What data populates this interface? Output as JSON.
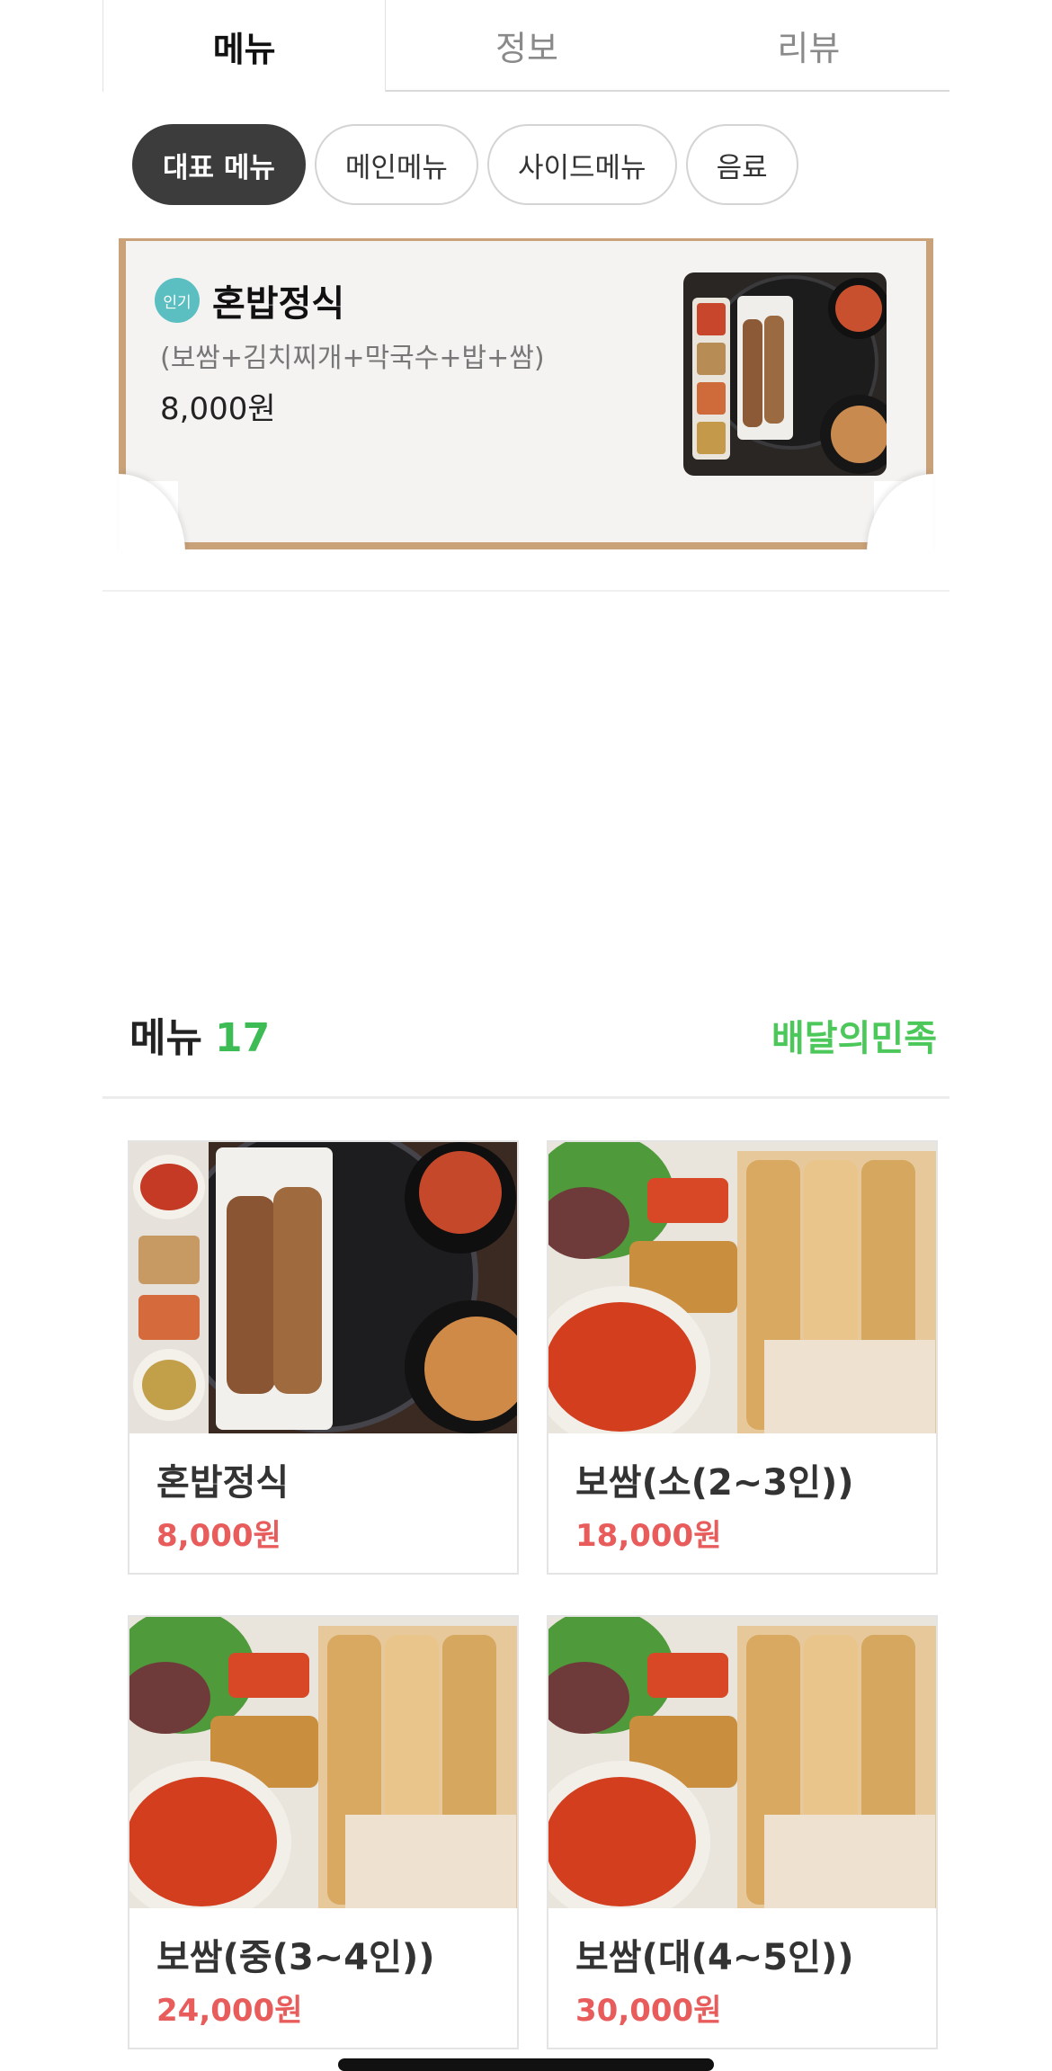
{
  "tabs": [
    {
      "label": "메뉴",
      "active": true
    },
    {
      "label": "정보",
      "active": false
    },
    {
      "label": "리뷰",
      "active": false
    }
  ],
  "chips": [
    {
      "label": "대표 메뉴",
      "active": true
    },
    {
      "label": "메인메뉴",
      "active": false
    },
    {
      "label": "사이드메뉴",
      "active": false
    },
    {
      "label": "음료",
      "active": false
    }
  ],
  "featured": {
    "badge": "인기",
    "name": "혼밥정식",
    "description": "(보쌈+김치찌개+막국수+밥+쌈)",
    "price": "8,000원"
  },
  "menu_header": {
    "title": "메뉴",
    "count": "17",
    "brand": "배달의민족"
  },
  "menu_items": [
    {
      "name": "혼밥정식",
      "price": "8,000원"
    },
    {
      "name": "보쌈(소(2~3인))",
      "price": "18,000원"
    },
    {
      "name": "보쌈(중(3~4인))",
      "price": "24,000원"
    },
    {
      "name": "보쌈(대(4~5인))",
      "price": "30,000원"
    }
  ],
  "colors": {
    "accent_green": "#3dbb55",
    "price_red": "#e85c5c",
    "chip_active": "#3c3c3c",
    "frame_tan": "#c9a27a",
    "badge_teal": "#5bbfc1"
  }
}
